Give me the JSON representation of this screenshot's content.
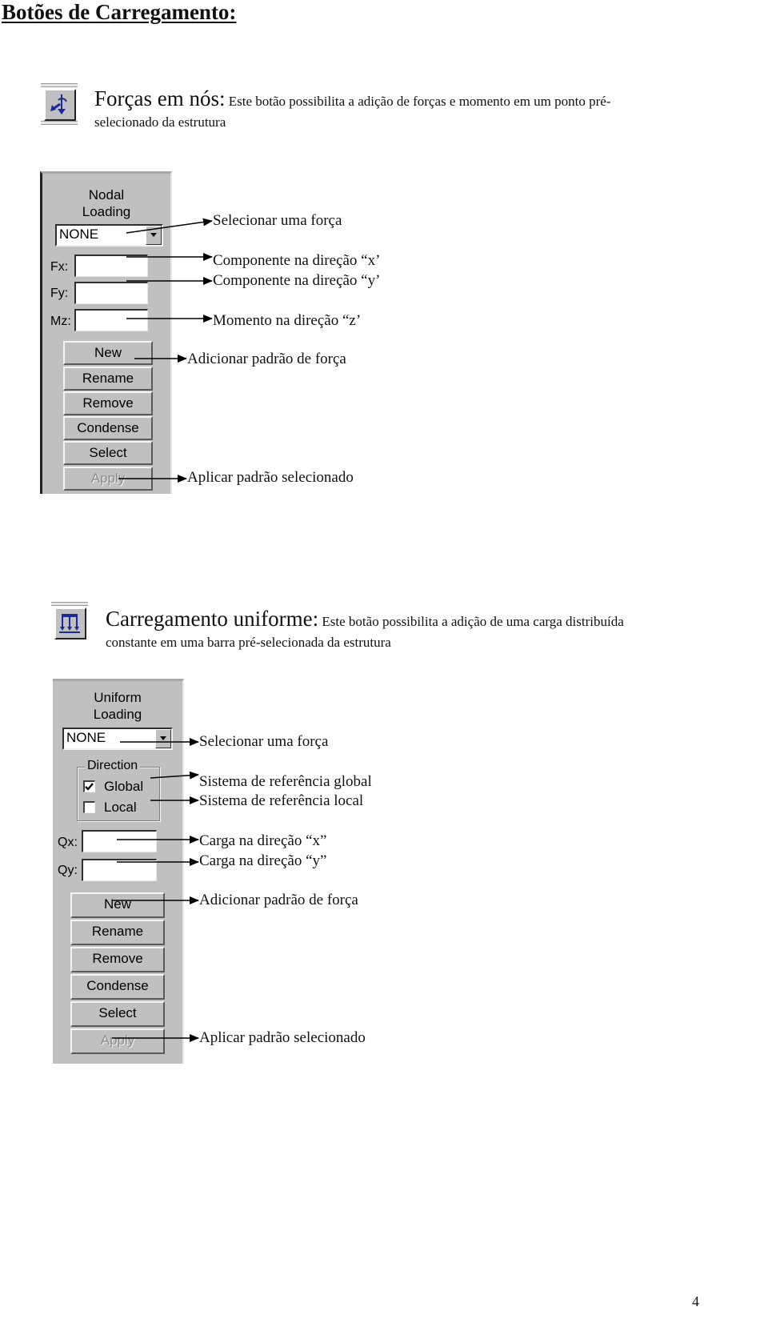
{
  "document": {
    "title": "Botões de Carregamento:",
    "page_number": "4"
  },
  "nodal_section": {
    "icon": "nodal-force-icon",
    "lead": "Forças em nós:",
    "description_line1": " Este botão possibilita a adição de forças e momento em um ponto pré-",
    "description_line2": "selecionado da estrutura",
    "panel": {
      "heading_line1": "Nodal",
      "heading_line2": "Loading",
      "combo_value": "NONE",
      "fields": [
        {
          "label": "Fx:",
          "value": ""
        },
        {
          "label": "Fy:",
          "value": ""
        },
        {
          "label": "Mz:",
          "value": ""
        }
      ],
      "buttons": [
        {
          "label": "New",
          "enabled": true
        },
        {
          "label": "Rename",
          "enabled": true
        },
        {
          "label": "Remove",
          "enabled": true
        },
        {
          "label": "Condense",
          "enabled": true
        },
        {
          "label": "Select",
          "enabled": true
        },
        {
          "label": "Apply",
          "enabled": false
        }
      ]
    },
    "annotations": [
      "Selecionar uma força",
      "Componente na direção “x’",
      "Componente na direção “y’",
      "Momento na direção “z’",
      "Adicionar padrão de força",
      "Aplicar padrão selecionado"
    ]
  },
  "uniform_section": {
    "icon": "uniform-load-icon",
    "lead": "Carregamento uniforme:",
    "description_line1": " Este botão possibilita a adição de uma carga distribuída",
    "description_line2": "constante em uma barra pré-selecionada da estrutura",
    "panel": {
      "heading_line1": "Uniform",
      "heading_line2": "Loading",
      "combo_value": "NONE",
      "direction_group": {
        "legend": "Direction",
        "options": [
          {
            "label": "Global",
            "checked": true
          },
          {
            "label": "Local",
            "checked": false
          }
        ]
      },
      "fields": [
        {
          "label": "Qx:",
          "value": ""
        },
        {
          "label": "Qy:",
          "value": ""
        }
      ],
      "buttons": [
        {
          "label": "New",
          "enabled": true
        },
        {
          "label": "Rename",
          "enabled": true
        },
        {
          "label": "Remove",
          "enabled": true
        },
        {
          "label": "Condense",
          "enabled": true
        },
        {
          "label": "Select",
          "enabled": true
        },
        {
          "label": "Apply",
          "enabled": false
        }
      ]
    },
    "annotations": [
      "Selecionar uma força",
      "Sistema de referência global",
      "Sistema de referência local",
      "Carga na direção “x”",
      "Carga na direção “y”",
      "Adicionar padrão de força",
      "Aplicar padrão selecionado"
    ]
  }
}
